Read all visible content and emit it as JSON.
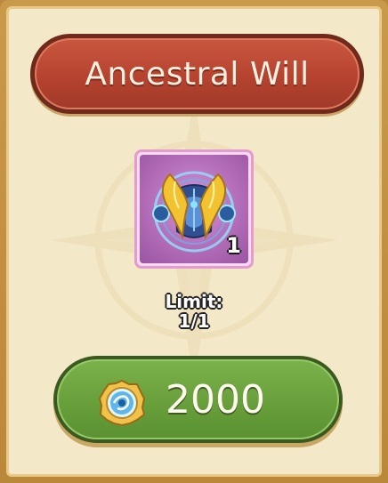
{
  "title": "Ancestral Will",
  "item": {
    "name": "Ancestral Will",
    "icon": "golden-winged-helmet-icon",
    "quantity": "1",
    "rarity_color": "#e49bd0"
  },
  "limit": {
    "label": "Limit:",
    "value": "1/1"
  },
  "purchase": {
    "currency_icon": "blue-crystal-coin-icon",
    "price": "2000"
  },
  "colors": {
    "banner": "#b5432f",
    "button": "#6aa13c",
    "panel": "#f3e8c8",
    "frame": "#c99a4a"
  }
}
